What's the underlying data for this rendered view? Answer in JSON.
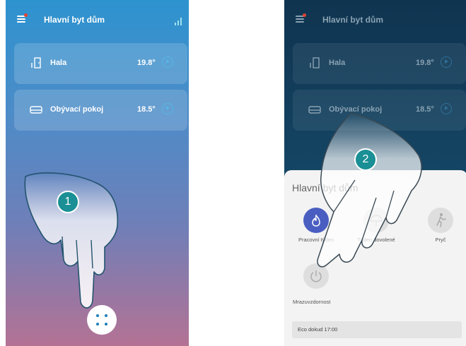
{
  "app_title": "Hlavní byt dům",
  "rooms": [
    {
      "name": "Hala",
      "temperature": "19.8°"
    },
    {
      "name": "Obývací pokoj",
      "temperature": "18.5°"
    }
  ],
  "steps": [
    "1",
    "2"
  ],
  "sheet": {
    "title": "Hlavní byt dům",
    "modes": [
      {
        "label": "Pracovní týden",
        "icon": "flame-icon",
        "active": true
      },
      {
        "label": "Týden dovolené",
        "icon": "umbrella-icon",
        "active": false
      },
      {
        "label": "Pryč",
        "icon": "walking-person-icon",
        "active": false
      },
      {
        "label": "Mrazuvzdornost",
        "icon": "power-icon",
        "active": false
      }
    ],
    "eco_status": "Eco dokud 17:00"
  },
  "colors": {
    "accent": "#1a8f95",
    "active_mode": "#4a5ec2"
  }
}
